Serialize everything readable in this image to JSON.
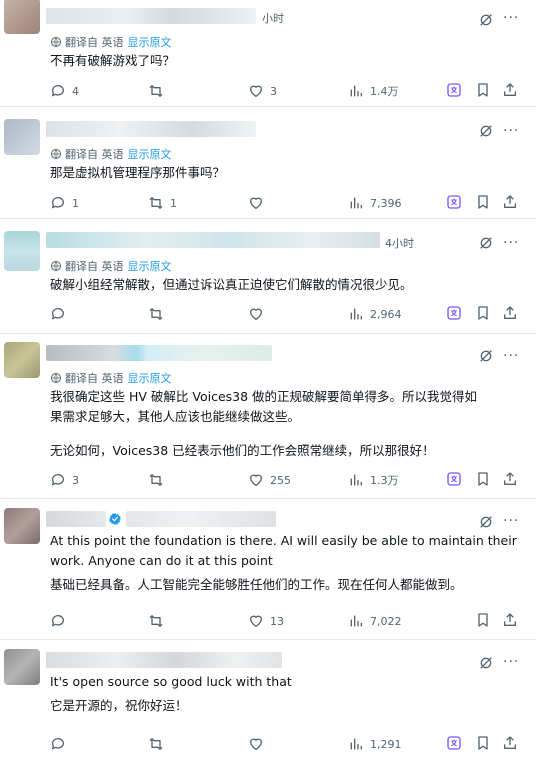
{
  "translation": {
    "label": "翻译自 英语",
    "show_original": "显示原文"
  },
  "more_symbol": "···",
  "colors": {
    "accent": "#1d9bf0",
    "secondary_text": "#536471",
    "bookmark_bg": "#7856ff"
  },
  "posts": [
    {
      "time": "小时",
      "text": [
        "不再有破解游戏了吗？"
      ],
      "replies": "4",
      "reposts": "",
      "likes": "3",
      "views": "1.4万"
    },
    {
      "time": "",
      "text": [
        "那是虚拟机管理程序那件事吗？"
      ],
      "replies": "1",
      "reposts": "1",
      "likes": "",
      "views": "7,396"
    },
    {
      "time": "4小时",
      "text": [
        "破解小组经常解散，但通过诉讼真正迫使它们解散的情况很少见。"
      ],
      "replies": "",
      "reposts": "",
      "likes": "",
      "views": "2,964"
    },
    {
      "time": "",
      "text": [
        "我很确定这些 HV 破解比 Voices38 做的正规破解要简单得多。所以我觉得如",
        "果需求足够大，其他人应该也能继续做这些。",
        "",
        "无论如何，Voices38 已经表示他们的工作会照常继续，所以那很好！"
      ],
      "replies": "3",
      "reposts": "",
      "likes": "255",
      "views": "1.3万"
    },
    {
      "time": "",
      "text": [
        "At this point the foundation is there. AI will easily be able to maintain their",
        "work. Anyone can do it at this point",
        "基础已经具备。人工智能完全能够胜任他们的工作。现在任何人都能做到。"
      ],
      "replies": "",
      "reposts": "",
      "likes": "13",
      "views": "7,022"
    },
    {
      "time": "",
      "text": [
        "It's open source so good luck with that",
        "它是开源的，祝你好运！"
      ],
      "replies": "",
      "reposts": "",
      "likes": "",
      "views": "1,291"
    }
  ]
}
